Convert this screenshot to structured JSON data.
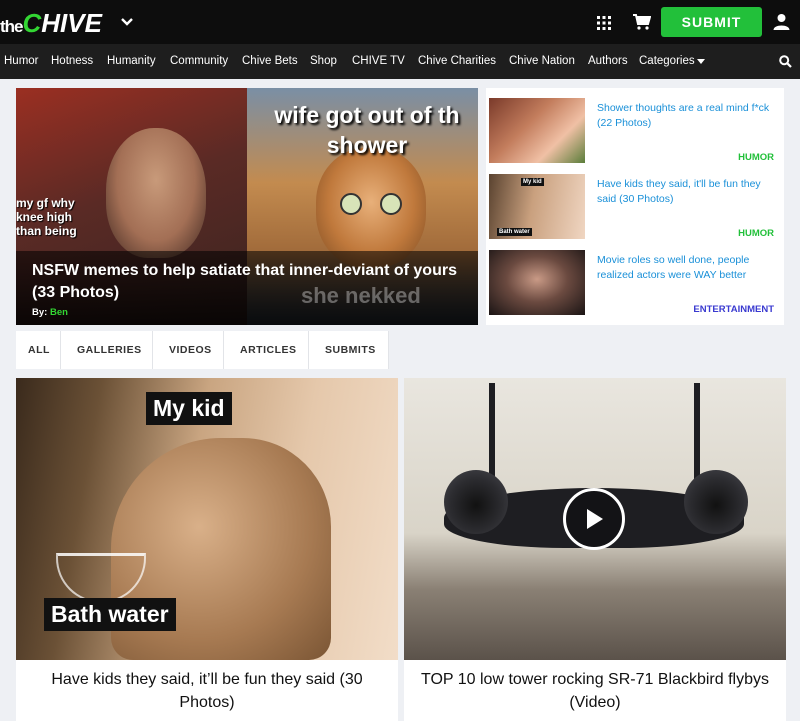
{
  "header": {
    "logo_the": "the",
    "logo_chive_c": "C",
    "logo_chive_rest": "HIVE",
    "submit_label": "SUBMIT"
  },
  "nav": {
    "items": [
      "Humor",
      "Hotness",
      "Humanity",
      "Community",
      "Chive Bets",
      "Shop",
      "CHIVE TV",
      "Chive Charities",
      "Chive Nation",
      "Authors",
      "Categories"
    ]
  },
  "hero": {
    "title": "NSFW memes to help satiate that inner-deviant of yours (33 Photos)",
    "by_label": "By:",
    "author": "Ben",
    "left_meme_text": "my gf why\nknee high\nthan being",
    "right_meme_text": "wife got out of th\nshower",
    "ghost_text": "she nekked"
  },
  "side_list": [
    {
      "title": "Shower thoughts are a real mind f*ck (22 Photos)",
      "category": "HUMOR",
      "category_color": "#22c03a"
    },
    {
      "title": "Have kids they said, it'll be fun they said (30 Photos)",
      "category": "HUMOR",
      "category_color": "#22c03a"
    },
    {
      "title": "Movie roles so well done, people realized actors were WAY better",
      "category": "ENTERTAINMENT",
      "category_color": "#3a3ad0"
    }
  ],
  "side_thumb_labels": {
    "my_kid": "My kid",
    "bath_water": "Bath water"
  },
  "tabs": [
    "ALL",
    "GALLERIES",
    "VIDEOS",
    "ARTICLES",
    "SUBMITS"
  ],
  "cards": [
    {
      "title": "Have kids they said, it’ll be fun they said (30 Photos)",
      "label_top": "My kid",
      "label_bottom": "Bath water"
    },
    {
      "title": "TOP 10 low tower rocking SR-71 Blackbird flybys (Video)"
    }
  ],
  "colors": {
    "brand_green": "#22c03a",
    "link_blue": "#1a90d8",
    "topbar": "#0d0d0d",
    "nav": "#1e1e1e"
  }
}
